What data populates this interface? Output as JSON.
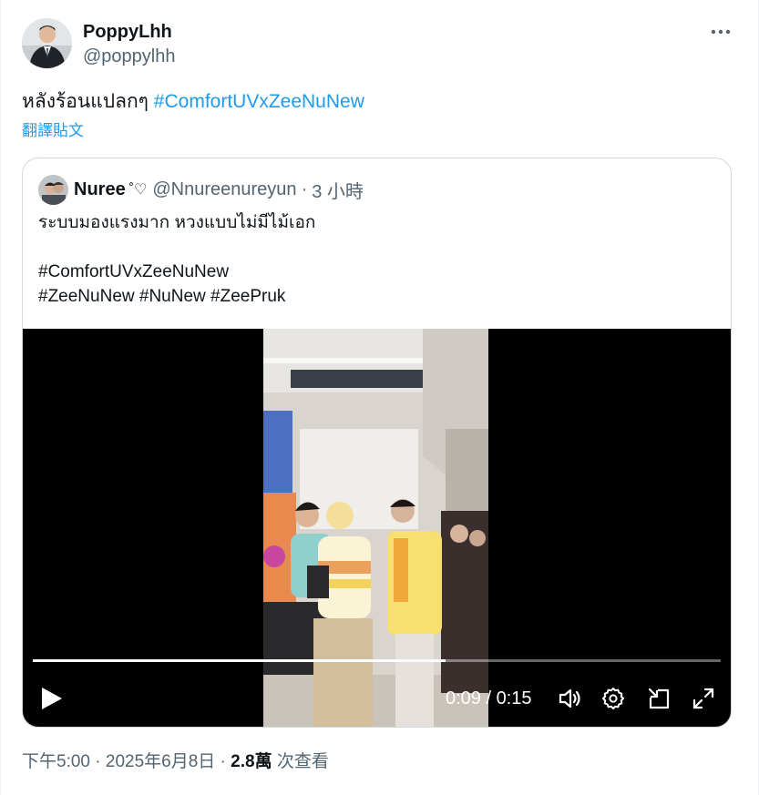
{
  "author": {
    "display_name": "PoppyLhh",
    "handle": "@poppylhh"
  },
  "tweet": {
    "text": "หลังร้อนแปลกๆ",
    "hashtag": "#ComfortUVxZeeNuNew",
    "translate_label": "翻譯貼文"
  },
  "quote": {
    "display_name": "Nuree",
    "emoji": "˚♡",
    "handle": "@Nnureenureyun",
    "separator": "·",
    "time": "3 小時",
    "lines": [
      "ระบบมองแรงมาก หวงแบบไม่มีไม้เอก",
      "",
      "#ComfortUVxZeeNuNew",
      "#ZeeNuNew #NuNew #ZeePruk"
    ]
  },
  "video": {
    "elapsed": "0:09",
    "divider": " / ",
    "duration": "0:15",
    "progress": 0.6
  },
  "meta": {
    "time": "下午5:00",
    "sep1": " · ",
    "date": "2025年6月8日",
    "sep2": " · ",
    "views_count": "2.8萬",
    "views_label": " 次查看"
  },
  "icons": {
    "more": "more-horizontal-icon",
    "play": "play-icon",
    "volume": "volume-icon",
    "settings": "gear-icon",
    "pip": "picture-in-picture-icon",
    "fullscreen": "fullscreen-icon"
  },
  "colors": {
    "accent": "#1d9bf0",
    "text": "#0f1419",
    "secondary": "#536471",
    "border": "#cfd9de"
  }
}
